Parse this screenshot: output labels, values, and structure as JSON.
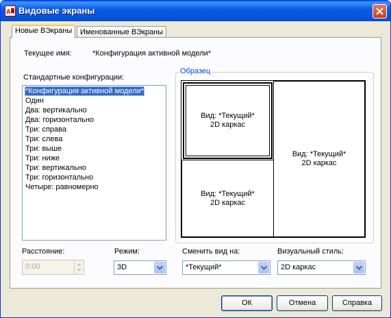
{
  "window": {
    "title": "Видовые экраны",
    "app_icon": "autocad-icon",
    "close_icon": "close-icon"
  },
  "tabs": [
    {
      "label": "Новые ВЭкраны",
      "active": true
    },
    {
      "label": "Именованные ВЭкраны",
      "active": false
    }
  ],
  "current_name": {
    "label": "Текущее имя:",
    "value": "*Конфигурация активной модели*"
  },
  "standard": {
    "label": "Стандартные конфигурации:",
    "items": [
      "*Конфигурация активной модели*",
      "Один",
      "Два: вертикально",
      "Два: горизонтально",
      "Три: справа",
      "Три: слева",
      "Три: выше",
      "Три: ниже",
      "Три: вертикально",
      "Три: горизонтально",
      "Четыре: равномерно"
    ],
    "selected_index": 0
  },
  "preview": {
    "label": "Образец",
    "viewports": [
      {
        "line1": "Вид: *Текущий*",
        "line2": "2D каркас"
      },
      {
        "line1": "Вид: *Текущий*",
        "line2": "2D каркас"
      },
      {
        "line1": "Вид: *Текущий*",
        "line2": "2D каркас"
      }
    ]
  },
  "spacing": {
    "label": "Расстояние:",
    "value": "0.00"
  },
  "mode": {
    "label": "Режим:",
    "value": "3D"
  },
  "change_view": {
    "label": "Сменить вид на:",
    "value": "*Текущий*"
  },
  "visual_style": {
    "label": "Визуальный стиль:",
    "value": "2D каркас"
  },
  "buttons": {
    "ok": "ОК",
    "cancel": "Отмена",
    "help": "Справка"
  },
  "colors": {
    "titlebar": "#0a5de6",
    "dialog_bg": "#ece9d8",
    "selection": "#316ac5",
    "group_legend": "#0046d5"
  }
}
